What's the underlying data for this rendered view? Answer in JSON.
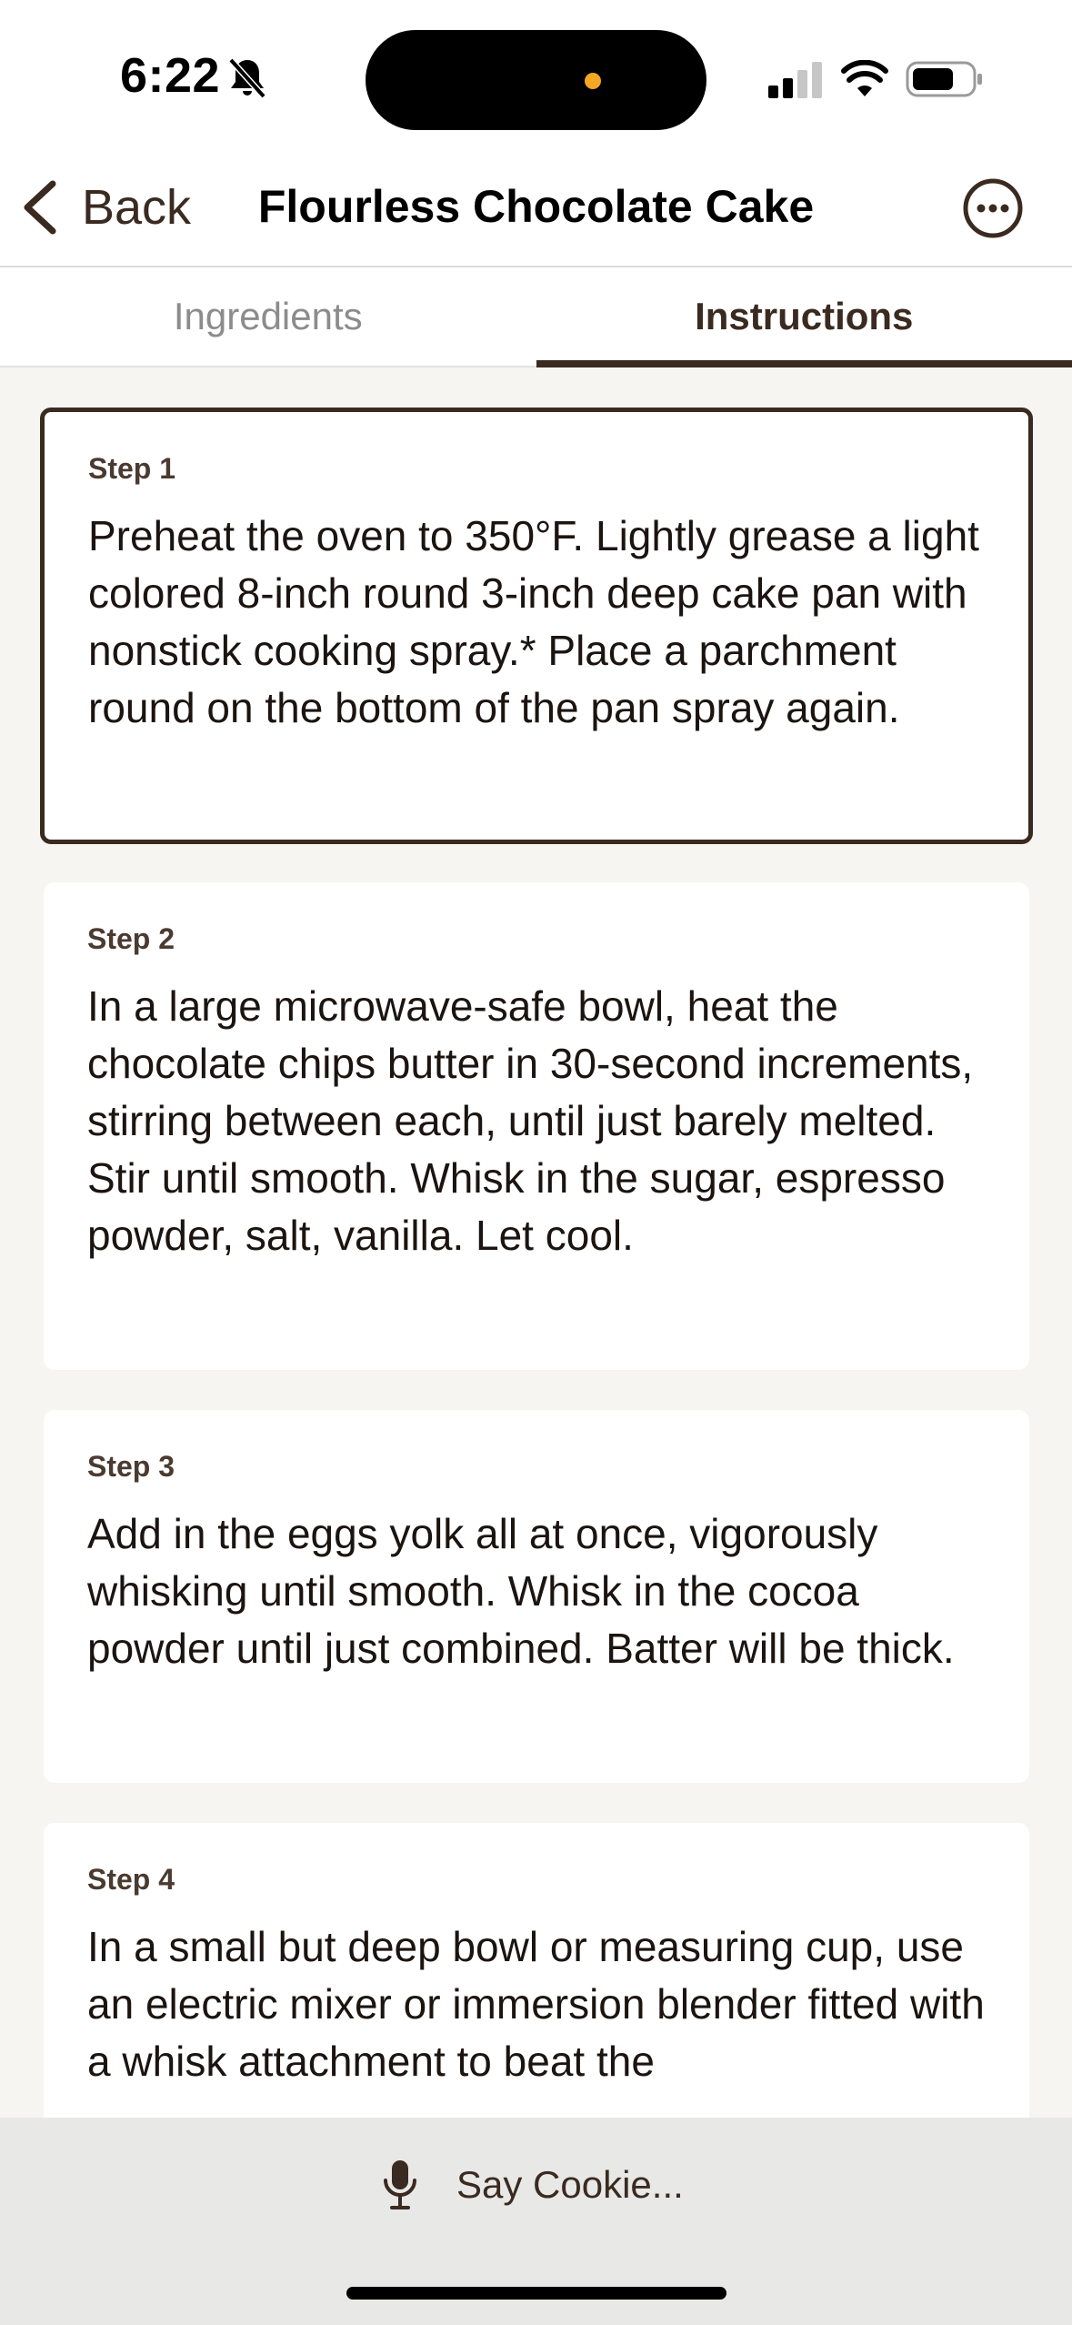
{
  "status_bar": {
    "time": "6:22",
    "icons": [
      "bell-slash-icon",
      "cellular-signal-icon",
      "wifi-icon",
      "battery-icon"
    ]
  },
  "header": {
    "back_label": "Back",
    "title": "Flourless Chocolate Cake",
    "more_icon": "ellipsis-circle-icon"
  },
  "tabs": [
    {
      "label": "Ingredients",
      "active": false
    },
    {
      "label": "Instructions",
      "active": true
    }
  ],
  "steps": [
    {
      "label": "Step 1",
      "text": "Preheat the oven to 350°F. Lightly grease a light colored 8-inch round 3-inch deep cake pan with nonstick cooking spray.* Place a parchment round on the bottom of the pan spray again.",
      "selected": true
    },
    {
      "label": "Step 2",
      "text": "In a large microwave-safe bowl, heat the chocolate chips butter in 30-second increments, stirring between each, until just barely melted. Stir until smooth. Whisk in the sugar, espresso powder, salt, vanilla. Let cool.",
      "selected": false
    },
    {
      "label": "Step 3",
      "text": "Add in the eggs yolk all at once, vigorously whisking until smooth. Whisk in the cocoa powder until just combined. Batter will be thick.",
      "selected": false
    },
    {
      "label": "Step 4",
      "text": "In a small but deep bowl or measuring cup, use an electric mixer or immersion blender fitted with a whisk attachment to beat the",
      "selected": false
    }
  ],
  "voice": {
    "placeholder": "Say Cookie...",
    "icon": "microphone-icon"
  },
  "colors": {
    "accent": "#3a2a20",
    "background": "#f6f5f2",
    "card": "#ffffff",
    "voice_bar": "#e8e8e6",
    "island_dot": "#f5a623"
  }
}
